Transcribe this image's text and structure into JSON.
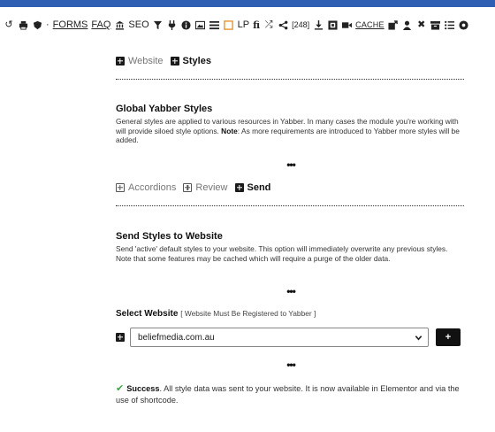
{
  "toolbar": {
    "forms_label": "FORMS",
    "faq_label": "FAQ",
    "seo_label": "SEO",
    "lp_label": "LP",
    "count_label": "[248]",
    "cache_label": "CACHE",
    "separator": "·",
    "icons": [
      "undo-icon",
      "printer-icon",
      "shield-icon",
      "bank-icon",
      "filter-icon",
      "plug-icon",
      "info-icon",
      "image-icon",
      "list-icon",
      "square-icon",
      "fi-icon",
      "shuffle-icon",
      "share-icon",
      "download-icon",
      "box-icon",
      "video-icon",
      "export-icon",
      "user-icon",
      "tools-icon",
      "archive-icon",
      "list-ul-icon",
      "settings-icon"
    ]
  },
  "top_tabs": {
    "website_label": "Website",
    "styles_label": "Styles"
  },
  "global": {
    "title": "Global Yabber Styles",
    "text_before": "General styles are applied to various resources in Yabber. In many cases the module you're working with will provide siloed style options. ",
    "note_label": "Note",
    "text_after": ": As more requirements are introduced to Yabber more styles will be added."
  },
  "ellipsis": "•••",
  "sub_tabs": {
    "accordions_label": "Accordions",
    "review_label": "Review",
    "send_label": "Send"
  },
  "send": {
    "title": "Send Styles to Website",
    "text": "Send 'active' default styles to your website. This option will immediately overwrite any previous styles. Note that some features may be cached which will require a purge of the older data."
  },
  "select_website": {
    "label": "Select Website",
    "note": "[ Website Must Be Registered to Yabber ]",
    "value": "beliefmedia.com.au",
    "add_label": "+"
  },
  "success": {
    "strong": "Success",
    "text": ". All style data was sent to your website. It is now available in Elementor and via the use of shortcode."
  },
  "colors": {
    "top_strip": "#2f5fb3",
    "success_check": "#3aa845",
    "button_bg": "#111111"
  }
}
